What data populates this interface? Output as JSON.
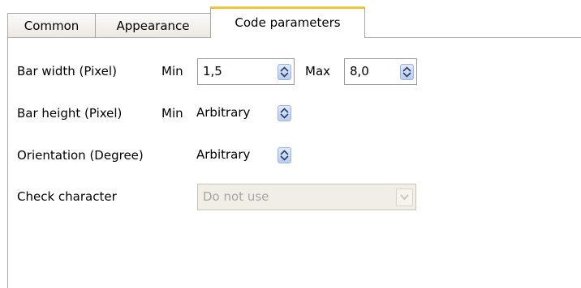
{
  "tabs": [
    "Common",
    "Appearance",
    "Code parameters"
  ],
  "active_tab": "Code parameters",
  "bar_width": {
    "label": "Bar width (Pixel)",
    "min_label": "Min",
    "min_value": "1,5",
    "max_label": "Max",
    "max_value": "8,0"
  },
  "bar_height": {
    "label": "Bar height (Pixel)",
    "min_label": "Min",
    "value": "Arbitrary"
  },
  "orientation": {
    "label": "Orientation (Degree)",
    "value": "Arbitrary"
  },
  "check_character": {
    "label": "Check character",
    "value": "Do not use"
  },
  "colors": {
    "active_tab_accent": "#f2c538",
    "spin_button": "#c7d7f5",
    "disabled_field": "#f0eee6"
  }
}
